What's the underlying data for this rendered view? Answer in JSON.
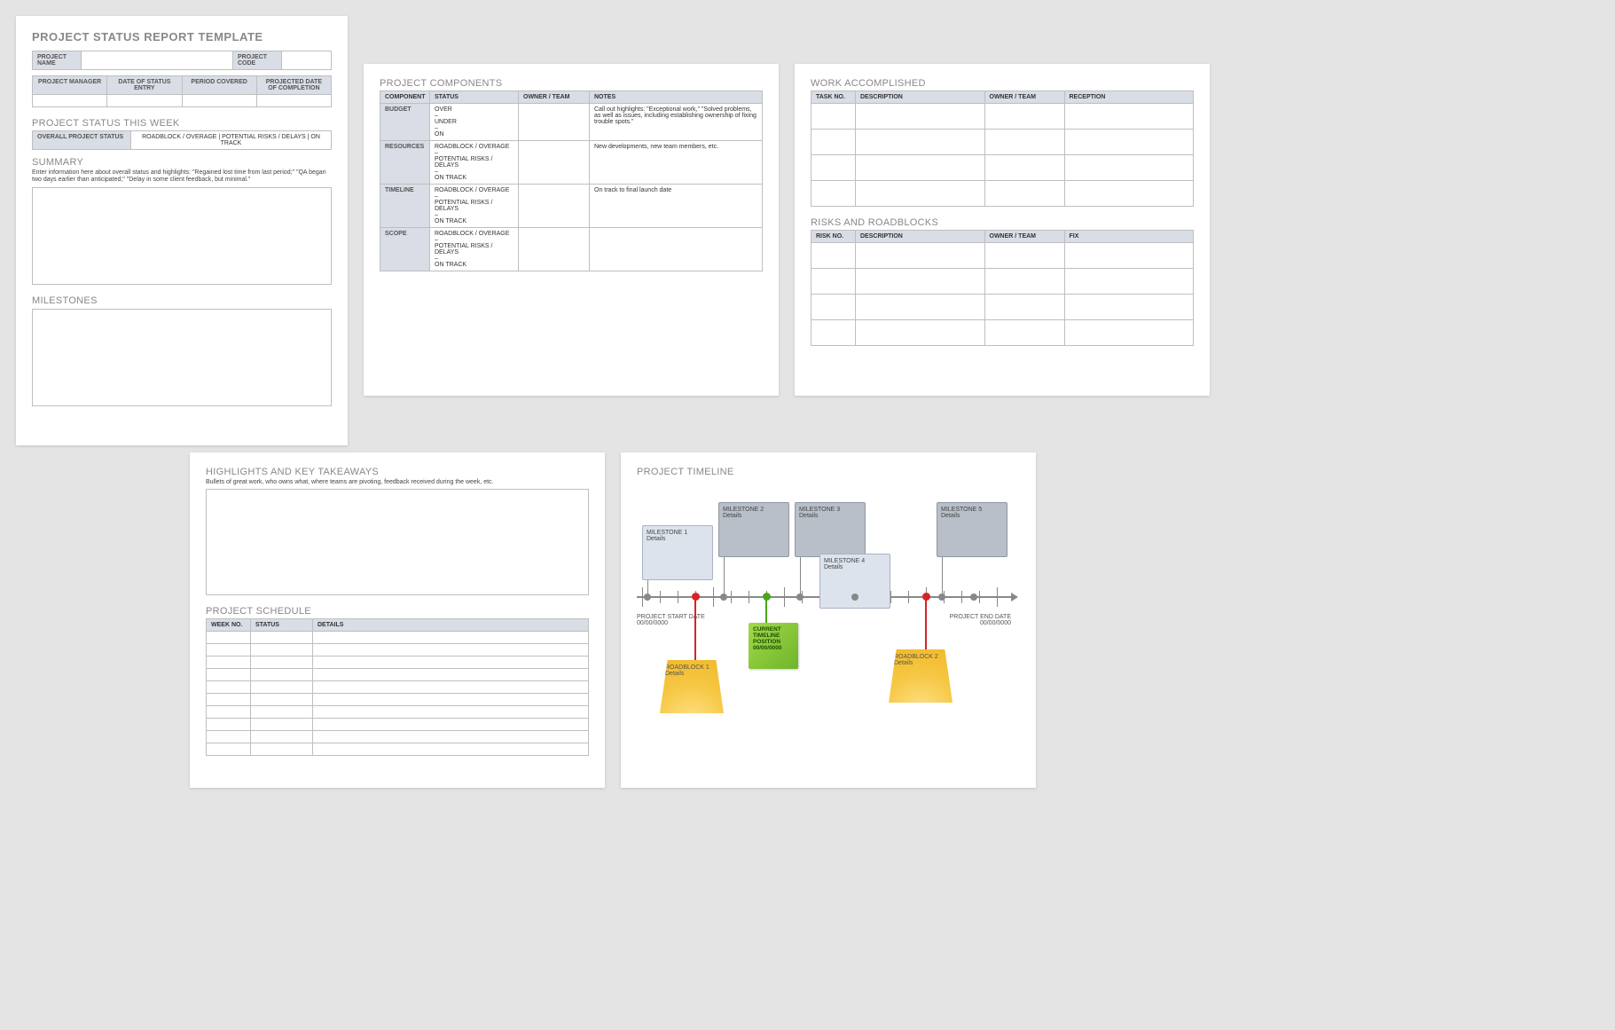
{
  "page1": {
    "title": "PROJECT STATUS REPORT TEMPLATE",
    "proj_name_label": "PROJECT NAME",
    "proj_code_label": "PROJECT CODE",
    "mgr": "PROJECT MANAGER",
    "entry": "DATE OF STATUS ENTRY",
    "period": "PERIOD COVERED",
    "projdate": "PROJECTED DATE OF COMPLETION",
    "status_week": "PROJECT STATUS THIS WEEK",
    "overall": "OVERALL PROJECT STATUS",
    "legend": "ROADBLOCK / OVERAGE   |   POTENTIAL RISKS / DELAYS   |   ON TRACK",
    "summary": "SUMMARY",
    "summary_help": "Enter information here about overall status and highlights: \"Regained lost time from last period;\" \"QA began two days earlier than anticipated;\" \"Delay in some client feedback, but minimal.\"",
    "milestones": "MILESTONES"
  },
  "page2": {
    "title": "PROJECT COMPONENTS",
    "cols": [
      "COMPONENT",
      "STATUS",
      "OWNER / TEAM",
      "NOTES"
    ],
    "rows": [
      {
        "name": "BUDGET",
        "status": "OVER\n–\nUNDER\n–\nON",
        "notes": "Call out highlights: \"Exceptional work,\" \"Solved problems, as well as issues, including establishing ownership of fixing trouble spots.\""
      },
      {
        "name": "RESOURCES",
        "status": "ROADBLOCK / OVERAGE\n–\nPOTENTIAL RISKS / DELAYS\n–\nON TRACK",
        "notes": "New developments, new team members, etc."
      },
      {
        "name": "TIMELINE",
        "status": "ROADBLOCK / OVERAGE\n–\nPOTENTIAL RISKS / DELAYS\n–\nON TRACK",
        "notes": "On track to final launch date"
      },
      {
        "name": "SCOPE",
        "status": "ROADBLOCK / OVERAGE\n–\nPOTENTIAL RISKS / DELAYS\n–\nON TRACK",
        "notes": ""
      }
    ]
  },
  "page3": {
    "work_title": "WORK ACCOMPLISHED",
    "work_cols": [
      "TASK NO.",
      "DESCRIPTION",
      "OWNER / TEAM",
      "RECEPTION"
    ],
    "risk_title": "RISKS AND ROADBLOCKS",
    "risk_cols": [
      "RISK NO.",
      "DESCRIPTION",
      "OWNER / TEAM",
      "FIX"
    ]
  },
  "page4": {
    "hl_title": "HIGHLIGHTS AND KEY TAKEAWAYS",
    "hl_help": "Bullets of great work, who owns what, where teams are pivoting, feedback received during the week, etc.",
    "sched_title": "PROJECT SCHEDULE",
    "sched_cols": [
      "WEEK NO.",
      "STATUS",
      "DETAILS"
    ]
  },
  "page5": {
    "title": "PROJECT TIMELINE",
    "start_label": "PROJECT START DATE",
    "start_date": "00/00/0000",
    "end_label": "PROJECT END DATE",
    "end_date": "00/00/0000",
    "milestones": [
      {
        "label": "MILESTONE 1",
        "detail": "Details"
      },
      {
        "label": "MILESTONE 2",
        "detail": "Details"
      },
      {
        "label": "MILESTONE 3",
        "detail": "Details"
      },
      {
        "label": "MILESTONE 4",
        "detail": "Details"
      },
      {
        "label": "MILESTONE 5",
        "detail": "Details"
      }
    ],
    "current": "CURRENT TIMELINE POSITION 00/00/0000",
    "roadblocks": [
      {
        "label": "ROADBLOCK 1",
        "detail": "Details"
      },
      {
        "label": "ROADBLOCK 2",
        "detail": "Details"
      }
    ]
  }
}
